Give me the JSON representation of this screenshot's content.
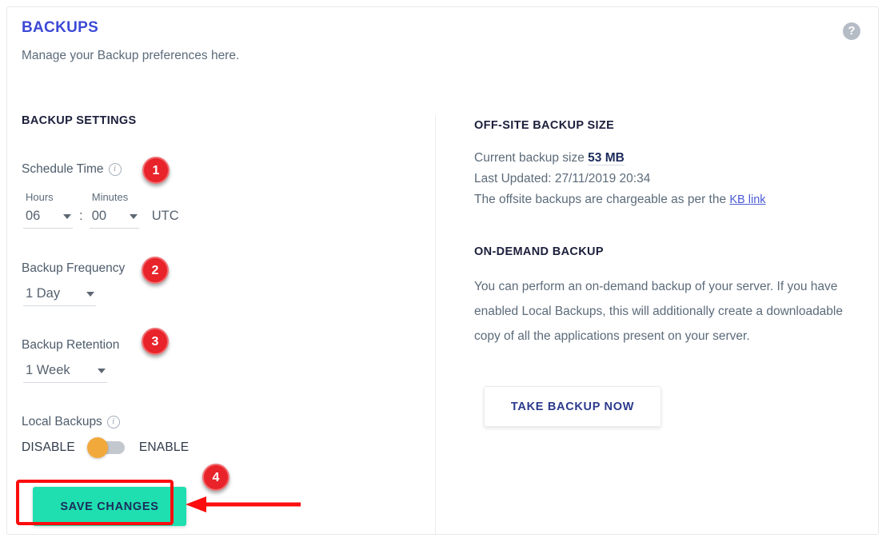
{
  "header": {
    "title": "BACKUPS",
    "subtitle": "Manage your Backup preferences here.",
    "help_icon_glyph": "?"
  },
  "left": {
    "section_heading": "BACKUP SETTINGS",
    "schedule": {
      "label": "Schedule Time",
      "info_glyph": "i",
      "hours_caption": "Hours",
      "hours_value": "06",
      "separator": ":",
      "minutes_caption": "Minutes",
      "minutes_value": "00",
      "timezone": "UTC"
    },
    "frequency": {
      "label": "Backup Frequency",
      "value": "1 Day"
    },
    "retention": {
      "label": "Backup Retention",
      "value": "1 Week"
    },
    "local_backups": {
      "label": "Local Backups",
      "info_glyph": "i",
      "off_label": "DISABLE",
      "on_label": "ENABLE",
      "state": "off",
      "knob_color": "#f2a93b",
      "track_color": "#c3c7ce"
    },
    "save_button_label": "SAVE CHANGES"
  },
  "right": {
    "offsite": {
      "heading": "OFF-SITE BACKUP SIZE",
      "size_prefix": "Current backup size ",
      "size_value": "53 MB",
      "last_updated": "Last Updated: 27/11/2019 20:34",
      "charge_note": "The offsite backups are chargeable as per the ",
      "kb_link_label": "KB link"
    },
    "ondemand": {
      "heading": "ON-DEMAND BACKUP",
      "body": "You can perform an on-demand backup of your server. If you have enabled Local Backups, this will additionally create a downloadable copy of all the applications present on your server.",
      "button_label": "TAKE BACKUP NOW"
    }
  },
  "annotations": {
    "badge_color": "#e8232a",
    "highlight_color": "#fd0d0d",
    "badges": [
      {
        "number": "1"
      },
      {
        "number": "2"
      },
      {
        "number": "3"
      },
      {
        "number": "4"
      }
    ]
  },
  "colors": {
    "title_blue": "#3c4ad6",
    "save_teal": "#1fdfb0",
    "navy_text": "#1b2b5b",
    "body_gray": "#5c6b7a",
    "link_blue": "#4a5bd4"
  }
}
